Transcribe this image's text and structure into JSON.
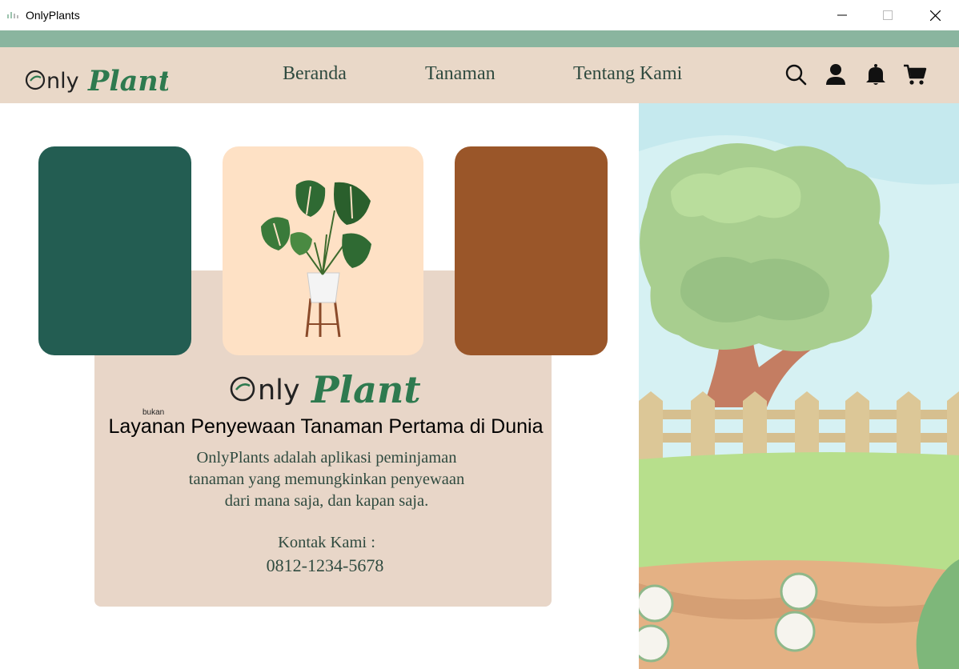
{
  "window": {
    "title": "OnlyPlants",
    "minimize_icon": "minimize-icon",
    "maximize_icon": "maximize-icon",
    "close_icon": "close-icon"
  },
  "navbar": {
    "brand": "OnlyPlants",
    "links": [
      "Beranda",
      "Tanaman",
      "Tentang Kami"
    ],
    "icons": [
      "search-icon",
      "user-icon",
      "bell-icon",
      "cart-icon"
    ]
  },
  "hero": {
    "swatch_colors": [
      "#235d52",
      "#fee1c5",
      "#9a5629"
    ],
    "card_background": "#e8d6c8",
    "brand": "OnlyPlants",
    "small_note": "bukan",
    "headline": "Layanan Penyewaan Tanaman Pertama di Dunia",
    "description_lines": [
      "OnlyPlants adalah aplikasi peminjaman",
      "tanaman yang memungkinkan penyewaan",
      "dari mana saja, dan kapan saja."
    ],
    "contact_label": "Kontak Kami :",
    "contact_phone": "0812-1234-5678"
  },
  "colors": {
    "top_stripe": "#8ab59f",
    "navbar_bg": "#e9d8c8",
    "nav_text": "#2f4a3f",
    "brand_green": "#2e7a4f"
  }
}
